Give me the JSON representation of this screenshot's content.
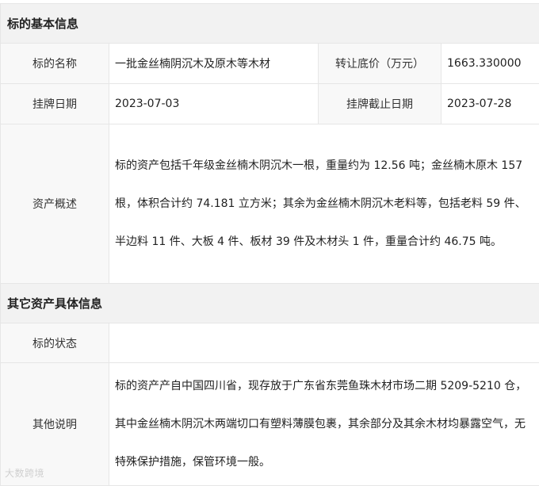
{
  "section_basic": "标的基本信息",
  "section_other": "其它资产具体信息",
  "name": {
    "label": "标的名称",
    "value": "一批金丝楠阴沉木及原木等木材"
  },
  "price": {
    "label": "转让底价（万元）",
    "value": "1663.330000"
  },
  "listing_date": {
    "label": "挂牌日期",
    "value": "2023-07-03"
  },
  "listing_deadline": {
    "label": "挂牌截止日期",
    "value": "2023-07-28"
  },
  "overview": {
    "label": "资产概述",
    "text": "标的资产包括千年级金丝楠木阴沉木一根，重量约为 12.56 吨；金丝楠木原木 157 根，体积合计约 74.181 立方米；其余为金丝楠木阴沉木老料等，包括老料 59 件、半边料 11 件、大板 4 件、板材 39 件及木材头 1 件，重量合计约 46.75 吨。"
  },
  "status": {
    "label": "标的状态",
    "value": ""
  },
  "other_notes": {
    "label": "其他说明",
    "text": "标的资产产自中国四川省，现存放于广东省东莞鱼珠木材市场二期 5209-5210 仓，其中金丝楠木阴沉木两端切口有塑料薄膜包裹，其余部分及其余木材均暴露空气，无特殊保护措施，保管环境一般。"
  },
  "watermark": "大数跨境"
}
